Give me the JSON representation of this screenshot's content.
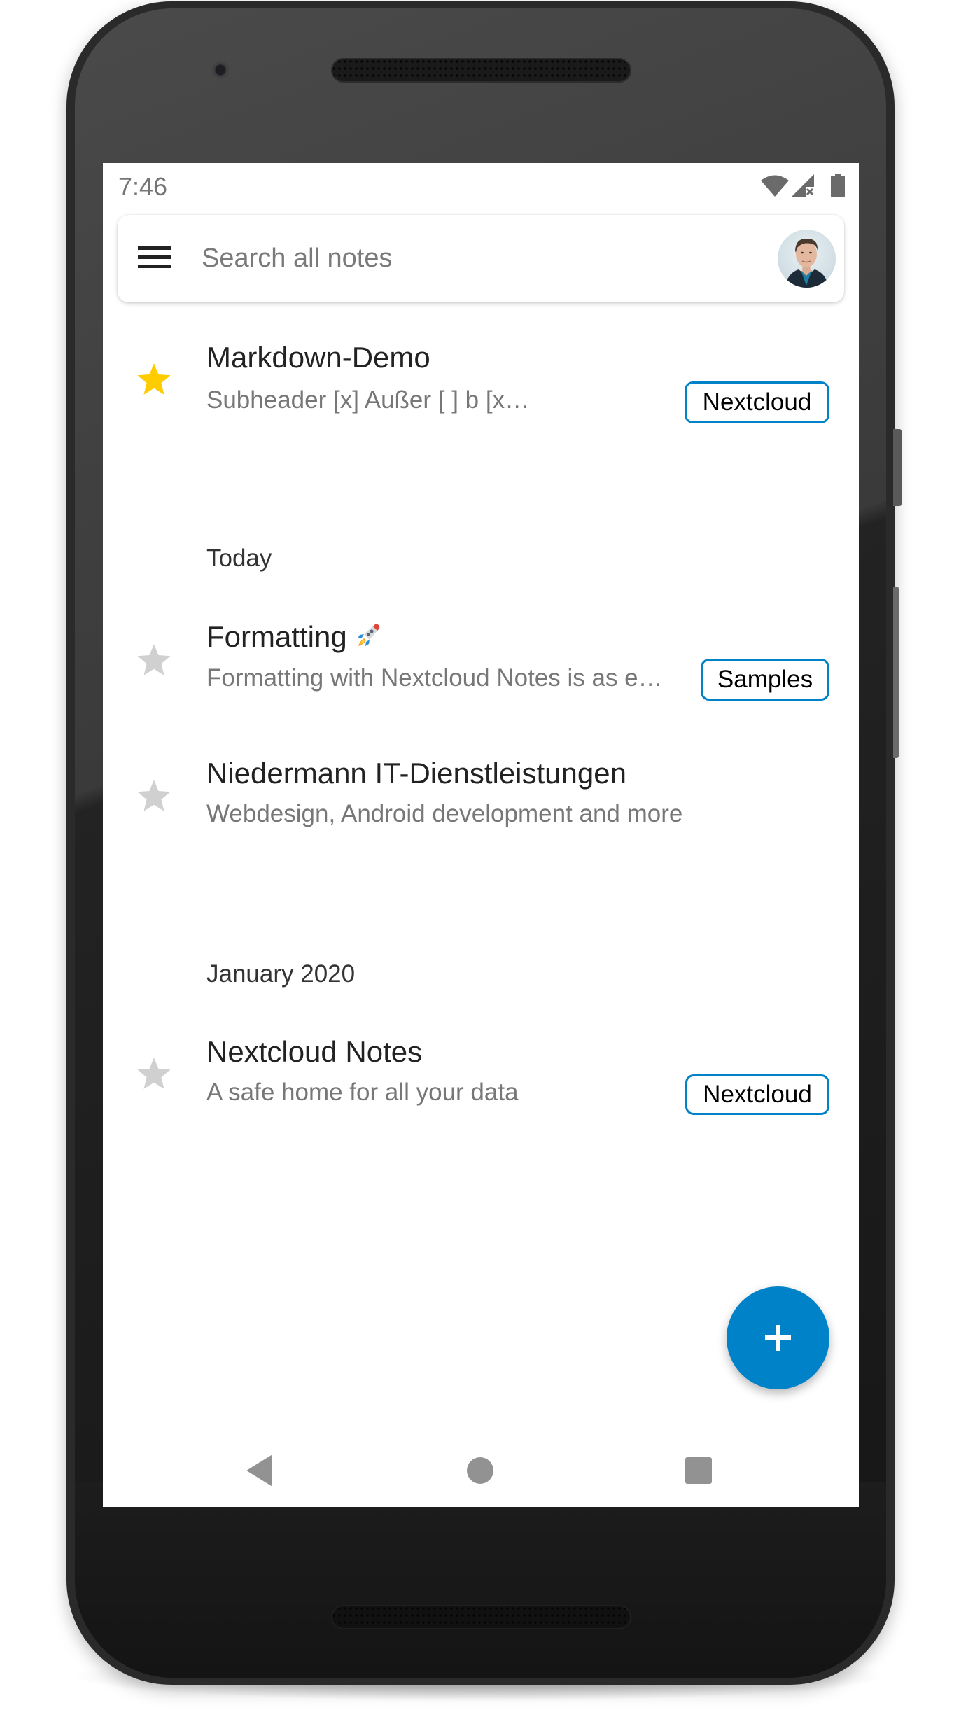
{
  "status_bar": {
    "time": "7:46",
    "icons": [
      "wifi-icon",
      "cellular-no-signal-icon",
      "battery-icon"
    ]
  },
  "search": {
    "placeholder": "Search all notes",
    "value": "",
    "menu_icon": "hamburger-menu-icon",
    "avatar": "user-avatar"
  },
  "notes_pinned": [
    {
      "title": "Markdown-Demo",
      "excerpt": "Subheader   [x] Außer   [ ] b   [x] c   [x] d ...",
      "category": "Nextcloud",
      "favorite": true
    }
  ],
  "sections": [
    {
      "header": "Today",
      "notes": [
        {
          "title": "Formatting",
          "title_emoji": "rocket",
          "excerpt": "Formatting with Nextcloud Notes is as e…",
          "category": "Samples",
          "favorite": false
        },
        {
          "title": "Niedermann IT-Dienstleistungen",
          "excerpt": "Webdesign, Android development and more",
          "category": "",
          "favorite": false
        }
      ]
    },
    {
      "header": "January 2020",
      "notes": [
        {
          "title": "Nextcloud Notes",
          "excerpt": "A safe home for all your data",
          "category": "Nextcloud",
          "favorite": false
        }
      ]
    }
  ],
  "fab": {
    "icon": "plus-icon",
    "label": "New note"
  },
  "nav_bar": [
    "back",
    "home",
    "recents"
  ],
  "colors": {
    "accent": "#0082C9",
    "favorite_star": "#FFCC00",
    "inactive_star": "#D0D0D0",
    "title_text": "#222222",
    "excerpt_text": "#777777",
    "nav_icon": "#929292"
  }
}
